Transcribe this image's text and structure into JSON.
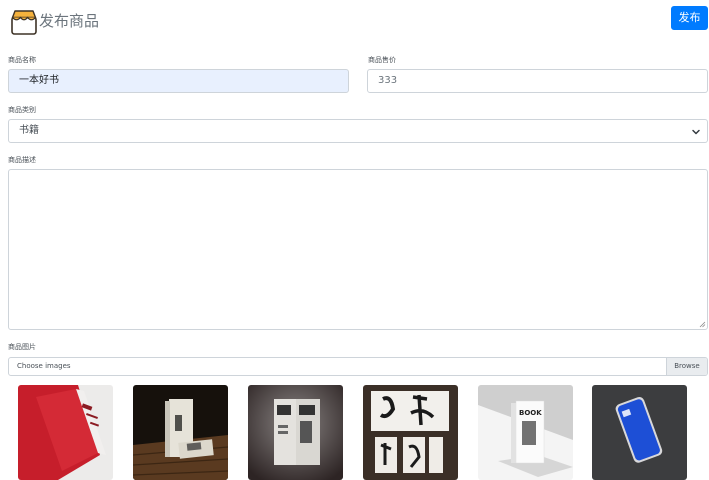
{
  "header": {
    "title": "发布商品",
    "publish_label": "发布"
  },
  "form": {
    "name_label": "商品名称",
    "name_value": "一本好书",
    "price_label": "商品售价",
    "price_value": "333",
    "category_label": "商品类别",
    "category_value": "书籍",
    "description_label": "商品描述",
    "description_value": "",
    "images_label": "商品图片",
    "file_placeholder": "Choose images",
    "browse_label": "Browse"
  },
  "thumbnails": [
    {
      "subject": "red-open-book"
    },
    {
      "subject": "books-on-wood-floor"
    },
    {
      "subject": "book-covers-dark"
    },
    {
      "subject": "calligraphy-spreads"
    },
    {
      "subject": "book-standing-white"
    },
    {
      "subject": "blue-phone"
    }
  ],
  "colors": {
    "primary": "#007bff",
    "autofill": "#e8f0fe",
    "border": "#ced4da"
  }
}
